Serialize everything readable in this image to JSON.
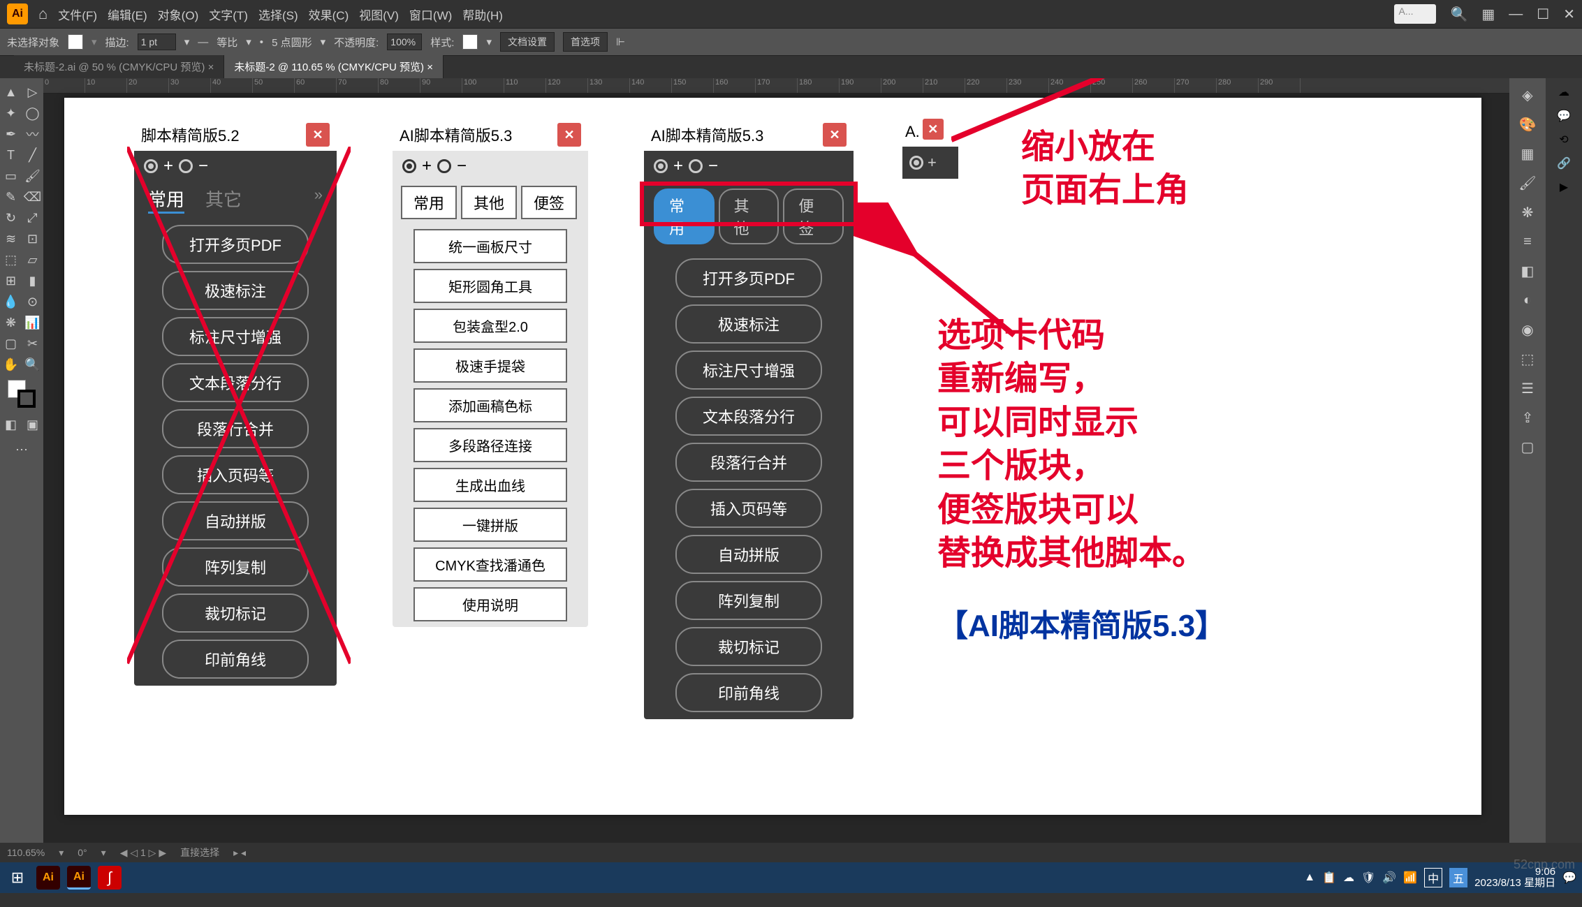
{
  "menubar": {
    "items": [
      "文件(F)",
      "编辑(E)",
      "对象(O)",
      "文字(T)",
      "选择(S)",
      "效果(C)",
      "视图(V)",
      "窗口(W)",
      "帮助(H)"
    ],
    "search_placeholder": "A..."
  },
  "controlbar": {
    "no_selection": "未选择对象",
    "stroke_label": "描边:",
    "stroke_value": "1 pt",
    "uniform": "等比",
    "point_round": "5 点圆形",
    "opacity_label": "不透明度:",
    "opacity_value": "100%",
    "style_label": "样式:",
    "doc_setup": "文档设置",
    "preferences": "首选项"
  },
  "tabs": [
    {
      "label": "未标题-2.ai @ 50 % (CMYK/CPU 预览)",
      "active": false
    },
    {
      "label": "未标题-2 @ 110.65 % (CMYK/CPU 预览)",
      "active": true
    }
  ],
  "ruler_marks": [
    "0",
    "10",
    "20",
    "30",
    "40",
    "50",
    "60",
    "70",
    "80",
    "90",
    "100",
    "110",
    "120",
    "130",
    "140",
    "150",
    "160",
    "170",
    "180",
    "190",
    "200",
    "210",
    "220",
    "230",
    "240",
    "250",
    "260",
    "270",
    "280",
    "290"
  ],
  "panel1": {
    "title": "脚本精简版5.2",
    "tabs": [
      "常用",
      "其它"
    ],
    "buttons": [
      "打开多页PDF",
      "极速标注",
      "标注尺寸增强",
      "文本段落分行",
      "段落行合并",
      "插入页码等",
      "自动拼版",
      "阵列复制",
      "裁切标记",
      "印前角线"
    ]
  },
  "panel2": {
    "title": "AI脚本精简版5.3",
    "tabs": [
      "常用",
      "其他",
      "便签"
    ],
    "buttons": [
      "统一画板尺寸",
      "矩形圆角工具",
      "包装盒型2.0",
      "极速手提袋",
      "添加画稿色标",
      "多段路径连接",
      "生成出血线",
      "一键拼版",
      "CMYK查找潘通色",
      "使用说明"
    ]
  },
  "panel3": {
    "title": "AI脚本精简版5.3",
    "tabs": [
      "常用",
      "其他",
      "便签"
    ],
    "buttons": [
      "打开多页PDF",
      "极速标注",
      "标注尺寸增强",
      "文本段落分行",
      "段落行合并",
      "插入页码等",
      "自动拼版",
      "阵列复制",
      "裁切标记",
      "印前角线"
    ]
  },
  "mini_panel": {
    "title": "A."
  },
  "annotation1": "缩小放在\n页面右上角",
  "annotation2": "选项卡代码\n重新编写，\n可以同时显示\n三个版块，\n便签版块可以\n替换成其他脚本。",
  "annotation3": "【AI脚本精简版5.3】",
  "statusbar": {
    "zoom": "110.65%",
    "rotate": "0°",
    "page": "1",
    "tool": "直接选择"
  },
  "taskbar": {
    "time": "9:06",
    "date": "2023/8/13 星期日",
    "ime_zh": "中",
    "ime_wu": "五"
  },
  "watermark": "52cnp.com"
}
